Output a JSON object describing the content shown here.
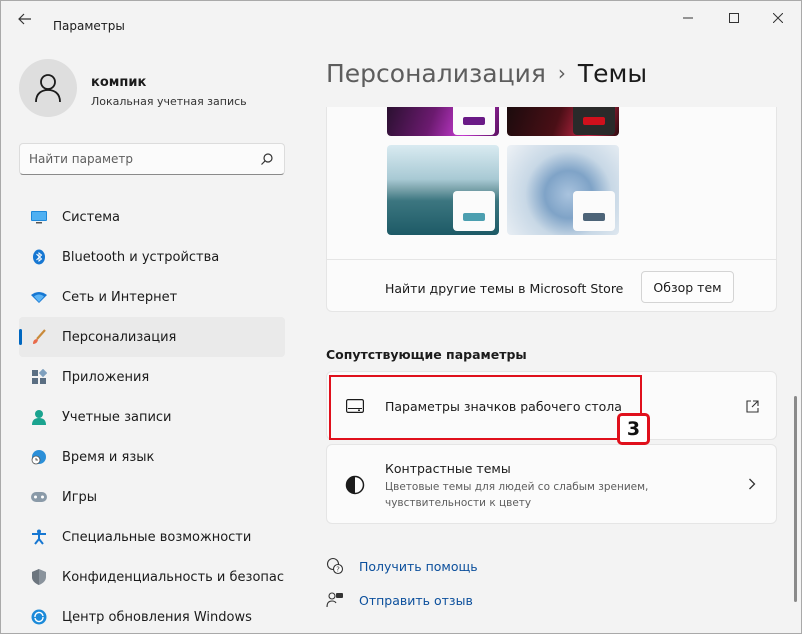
{
  "window": {
    "title": "Параметры"
  },
  "user": {
    "name": "компик",
    "account_type": "Локальная учетная запись"
  },
  "search": {
    "placeholder": "Найти параметр"
  },
  "sidebar": {
    "items": [
      {
        "label": "Система",
        "icon": "monitor-icon"
      },
      {
        "label": "Bluetooth и устройства",
        "icon": "bluetooth-icon"
      },
      {
        "label": "Сеть и Интернет",
        "icon": "wifi-icon"
      },
      {
        "label": "Персонализация",
        "icon": "brush-icon",
        "active": true
      },
      {
        "label": "Приложения",
        "icon": "apps-icon"
      },
      {
        "label": "Учетные записи",
        "icon": "person-icon"
      },
      {
        "label": "Время и язык",
        "icon": "globe-clock-icon"
      },
      {
        "label": "Игры",
        "icon": "gamepad-icon"
      },
      {
        "label": "Специальные возможности",
        "icon": "accessibility-icon"
      },
      {
        "label": "Конфиденциальность и безопас",
        "icon": "shield-icon"
      },
      {
        "label": "Центр обновления Windows",
        "icon": "update-icon"
      }
    ]
  },
  "breadcrumb": {
    "parent": "Персонализация",
    "separator": "›",
    "current": "Темы"
  },
  "themes": {
    "store_text": "Найти другие темы в Microsoft Store",
    "browse_button": "Обзор тем"
  },
  "related": {
    "section_title": "Сопутствующие параметры",
    "desktop_icons": {
      "title": "Параметры значков рабочего стола"
    },
    "contrast": {
      "title": "Контрастные темы",
      "subtitle_line1": "Цветовые темы для людей со слабым зрением,",
      "subtitle_line2": "чувствительности к цвету"
    }
  },
  "annotation": {
    "step": "3",
    "color": "#e0101c"
  },
  "links": {
    "help": "Получить помощь",
    "feedback": "Отправить отзыв"
  },
  "colors": {
    "accent": "#0067c0",
    "link": "#0b4f9c"
  }
}
